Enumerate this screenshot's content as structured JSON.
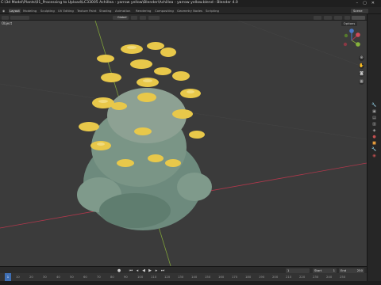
{
  "window": {
    "title": "C:\\3d Model\\Plants\\01_Processing to Upload\\LC33005 Achillea - yarrow yellow\\Blender\\Achillea - yarrow yellow.blend - Blender 4.0",
    "controls": [
      "–",
      "▢",
      "✕"
    ]
  },
  "workspaces": [
    "Layout",
    "Modeling",
    "Sculpting",
    "UV Editing",
    "Texture Paint",
    "Shading",
    "Animation",
    "Rendering",
    "Compositing",
    "Geometry Nodes",
    "Scripting"
  ],
  "scene": {
    "label": "Scene"
  },
  "header": {
    "orientation": "Global"
  },
  "viewport": {
    "object_label": "Object",
    "options_label": "Options"
  },
  "timeline": {
    "start_label": "Start",
    "start_value": "1",
    "end_label": "End",
    "end_value": "250",
    "current_frame": "1",
    "ruler": [
      "0",
      "10",
      "20",
      "30",
      "40",
      "50",
      "60",
      "70",
      "80",
      "90",
      "100",
      "110",
      "120",
      "130",
      "140",
      "150",
      "160",
      "170",
      "180",
      "190",
      "200",
      "210",
      "220",
      "230",
      "240",
      "250"
    ]
  },
  "colors": {
    "viewport_bg": "#3b3b3b",
    "flower_yellow": "#e8c84a",
    "foliage": "#6d8a7d",
    "x_axis": "#b0384c",
    "y_axis": "#7fa13a",
    "active_frame": "#3f6fb4"
  },
  "icons": [
    "select-box-icon",
    "cursor-icon",
    "move-icon",
    "rotate-icon",
    "scale-icon",
    "transform-icon",
    "annotate-icon",
    "measure-icon",
    "camera-icon",
    "hand-icon",
    "zoom-icon",
    "grid-icon",
    "tool-icon",
    "scene-icon",
    "world-icon",
    "object-icon",
    "modifier-icon",
    "material-icon"
  ]
}
